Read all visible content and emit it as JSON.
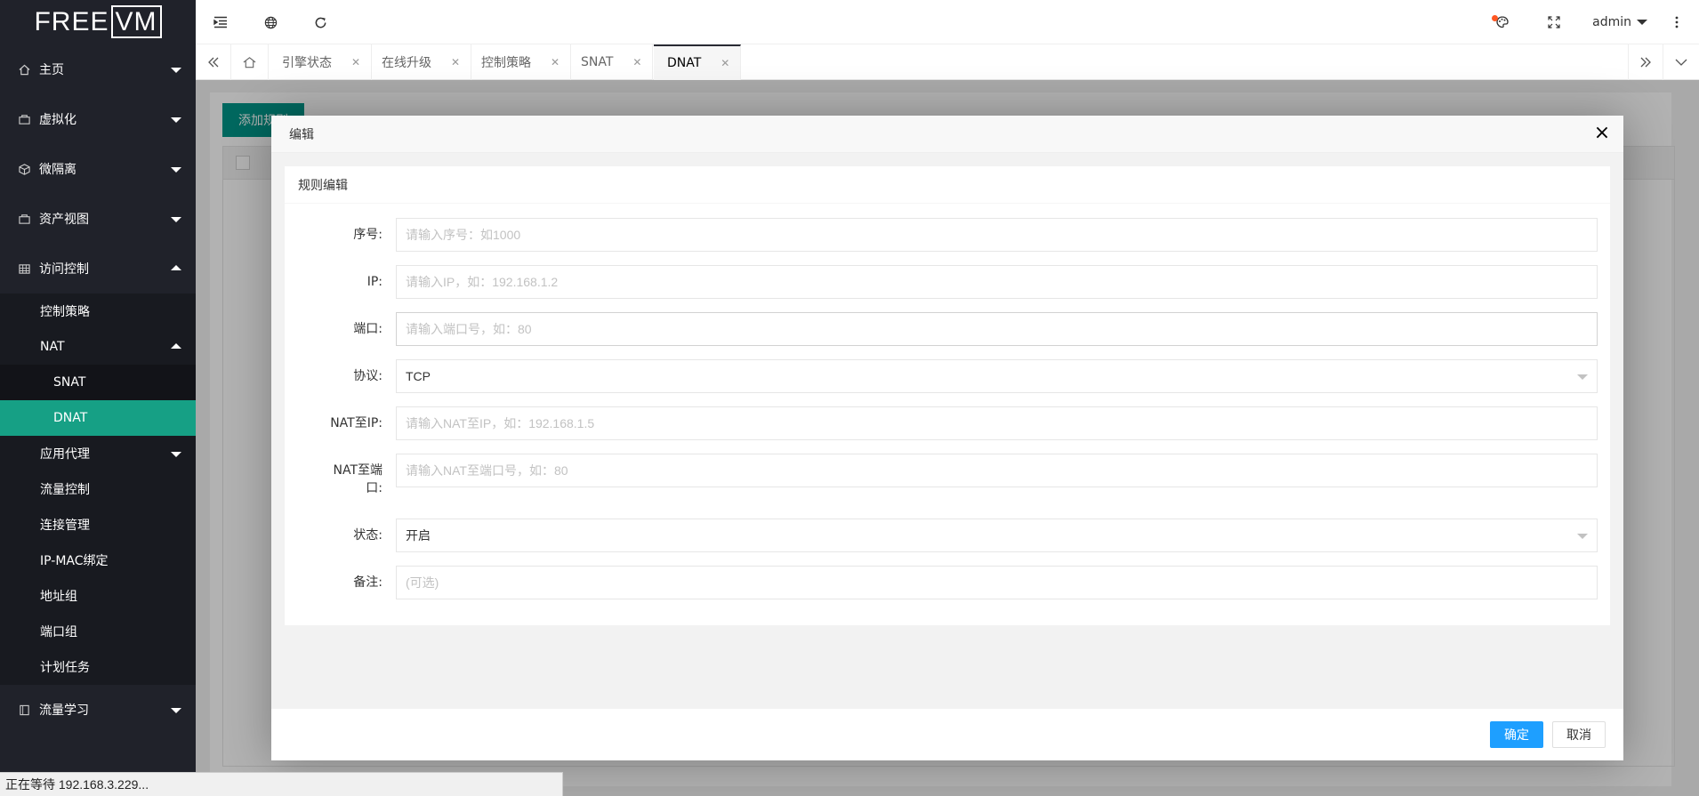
{
  "app": {
    "logo_free": "FREE",
    "logo_vm": "VM"
  },
  "sidebar": {
    "items": [
      {
        "label": "主页",
        "icon": "home-icon"
      },
      {
        "label": "虚拟化",
        "icon": "server-icon"
      },
      {
        "label": "微隔离",
        "icon": "cube-icon"
      },
      {
        "label": "资产视图",
        "icon": "server-icon"
      },
      {
        "label": "访问控制",
        "icon": "table-icon"
      }
    ],
    "access_sub": {
      "policy": "控制策略",
      "nat": "NAT",
      "snat": "SNAT",
      "dnat": "DNAT",
      "app_proxy": "应用代理",
      "flow_control": "流量控制",
      "conn_mgmt": "连接管理",
      "ip_mac": "IP-MAC绑定",
      "addr_group": "地址组",
      "port_group": "端口组",
      "scheduled": "计划任务"
    },
    "flow_learning": "流量学习"
  },
  "header": {
    "user": "admin"
  },
  "tabs": [
    {
      "label": "引擎状态"
    },
    {
      "label": "在线升级"
    },
    {
      "label": "控制策略"
    },
    {
      "label": "SNAT"
    },
    {
      "label": "DNAT"
    }
  ],
  "background": {
    "btn_add": "添加规则"
  },
  "dialog": {
    "title": "编辑",
    "card_title": "规则编辑",
    "fields": {
      "seq": {
        "label": "序号:",
        "placeholder": "请输入序号：如1000"
      },
      "ip": {
        "label": "IP:",
        "placeholder": "请输入IP，如：192.168.1.2"
      },
      "port": {
        "label": "端口:",
        "placeholder": "请输入端口号，如：80"
      },
      "proto": {
        "label": "协议:",
        "value": "TCP"
      },
      "nat_ip": {
        "label": "NAT至IP:",
        "placeholder": "请输入NAT至IP，如：192.168.1.5"
      },
      "nat_port": {
        "label": "NAT至端口:",
        "placeholder": "请输入NAT至端口号，如：80"
      },
      "status": {
        "label": "状态:",
        "value": "开启"
      },
      "note": {
        "label": "备注:",
        "placeholder": "(可选)"
      }
    },
    "ok": "确定",
    "cancel": "取消"
  },
  "statusbar": {
    "text": "正在等待 192.168.3.229..."
  },
  "colors": {
    "accent": "#16a085",
    "primary": "#1e9fff",
    "sidebar_bg": "#20222a"
  }
}
